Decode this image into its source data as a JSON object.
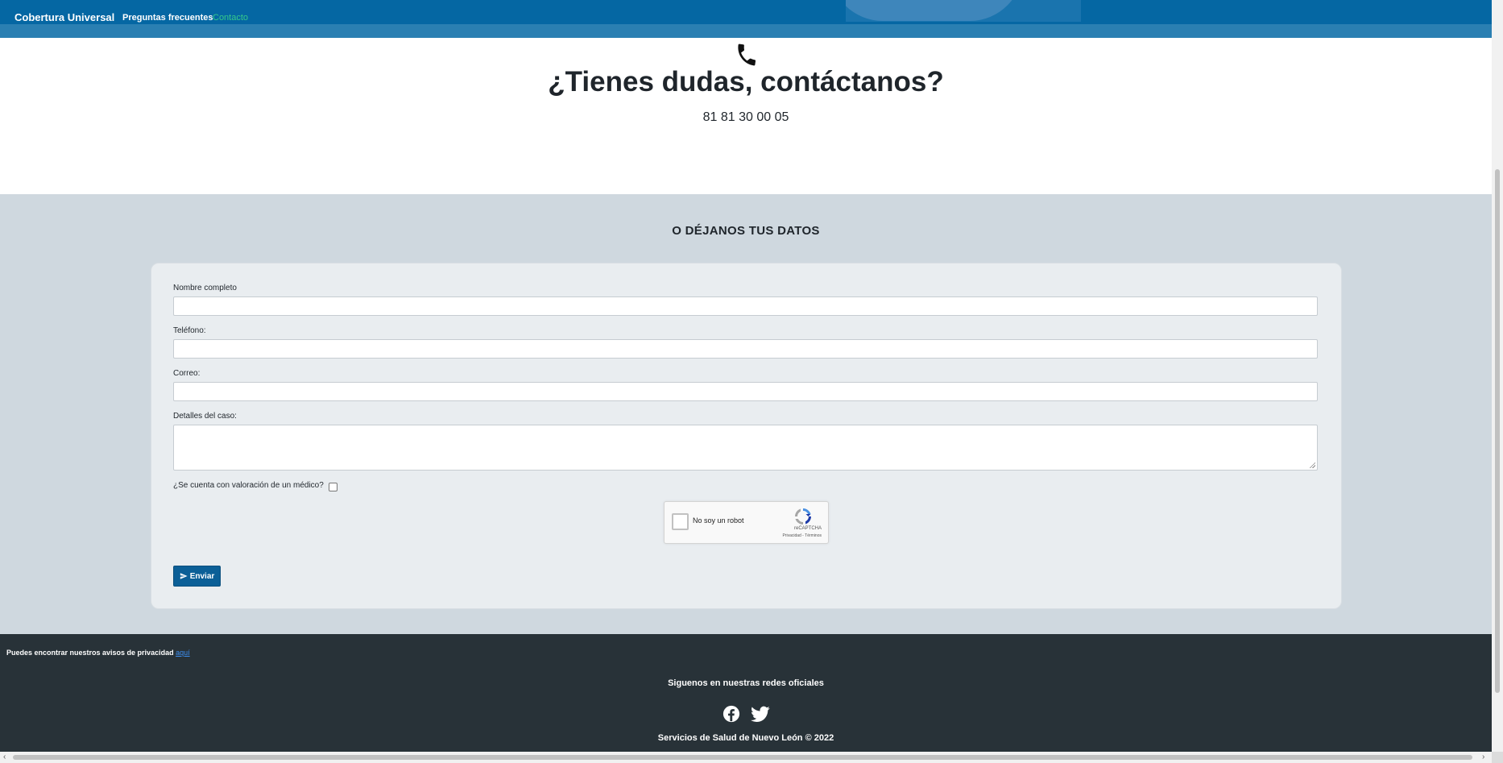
{
  "nav": {
    "brand": "Cobertura Universal",
    "links": [
      {
        "label": "Preguntas frecuentes"
      },
      {
        "label": "Contacto",
        "active": true
      }
    ],
    "bar_color": "#0567a3"
  },
  "hero": {
    "icon": "phone-icon",
    "title": "¿Tienes dudas, contáctanos?",
    "phone": "81 81 30 00 05"
  },
  "form_section": {
    "title": "O DÉJANOS TUS DATOS",
    "fields": {
      "name_label": "Nombre completo",
      "phone_label": "Teléfono:",
      "email_label": "Correo:",
      "details_label": "Detalles del caso:"
    },
    "values": {
      "name": "",
      "phone": "",
      "email": "",
      "details": ""
    },
    "medical_check_label": "¿Se cuenta con valoración de un médico?",
    "medical_checked": false,
    "recaptcha": {
      "label": "No soy un robot",
      "brand": "reCAPTCHA",
      "links": "Privacidad - Términos",
      "checked": false
    },
    "submit_label": "Enviar",
    "submit_icon": "send-icon",
    "button_color": "#0b5f97"
  },
  "footer": {
    "privacy_text": "Puedes encontrar nuestros avisos de privacidad",
    "privacy_link": "aquí",
    "follow_text": "Siguenos en nuestras redes oficiales",
    "social": [
      {
        "icon": "facebook-icon"
      },
      {
        "icon": "twitter-icon"
      }
    ],
    "copyright": "Servicios de Salud de Nuevo León © 2022",
    "bg_color": "#283238"
  }
}
